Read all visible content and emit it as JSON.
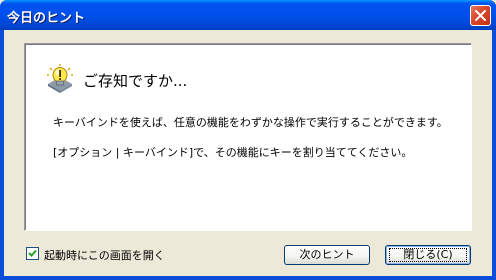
{
  "window": {
    "title": "今日のヒント"
  },
  "content": {
    "heading": "ご存知ですか...",
    "tips": [
      "キーバインドを使えば、任意の機能をわずかな操作で実行することができます。",
      "[オプション | キーバインド]で、その機能にキーを割り当ててください。"
    ]
  },
  "footer": {
    "show_on_startup_label": "起動時にこの画面を開く",
    "show_on_startup_checked": true,
    "next_tip_label": "次のヒント",
    "close_label": "閉じる(C)"
  },
  "colors": {
    "titlebar": "#0053ee",
    "close_button": "#d9462a",
    "dialog_background": "#ece9d8",
    "panel_background": "#ffffff"
  },
  "icons": {
    "tip": "lightbulb-icon",
    "close": "close-icon",
    "check": "checkmark-icon"
  }
}
